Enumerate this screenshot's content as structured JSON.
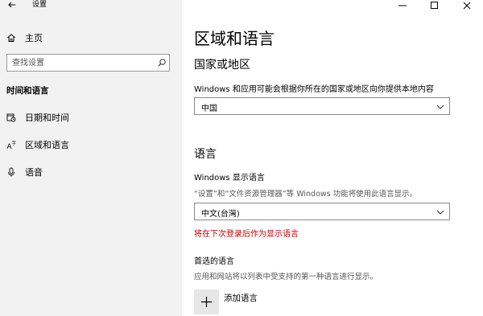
{
  "titlebar": {
    "app_title": "设置",
    "back_icon": "back-arrow-icon",
    "controls": {
      "minimize_icon": "minimize-icon",
      "maximize_icon": "maximize-icon",
      "close_icon": "close-icon"
    }
  },
  "sidebar": {
    "home": {
      "label": "主页",
      "icon": "home-icon"
    },
    "search": {
      "placeholder": "查找设置",
      "icon": "search-icon"
    },
    "section_heading": "时间和语言",
    "items": [
      {
        "label": "日期和时间",
        "icon": "calendar-clock-icon"
      },
      {
        "label": "区域和语言",
        "icon": "language-icon"
      },
      {
        "label": "语音",
        "icon": "microphone-icon"
      }
    ]
  },
  "main": {
    "page_title": "区域和语言",
    "region": {
      "heading": "国家或地区",
      "description": "Windows 和应用可能会根据你所在的国家或地区向你提供本地内容",
      "selected": "中国"
    },
    "language": {
      "heading": "语言",
      "display_language_label": "Windows 显示语言",
      "display_language_desc": "“设置”和“文件资源管理器”等 Windows 功能将使用此语言显示。",
      "display_language_selected": "中文(台灣)",
      "notice": "将在下次登录后作为显示语言"
    },
    "preferred": {
      "heading": "首选的语言",
      "description": "应用和网站将以列表中受支持的第一种语言进行显示。",
      "add_label": "添加语言"
    }
  },
  "colors": {
    "sidebar_bg": "#f2f2f2",
    "warning_text": "#c40000",
    "add_button_bg": "#e6e6e6"
  }
}
